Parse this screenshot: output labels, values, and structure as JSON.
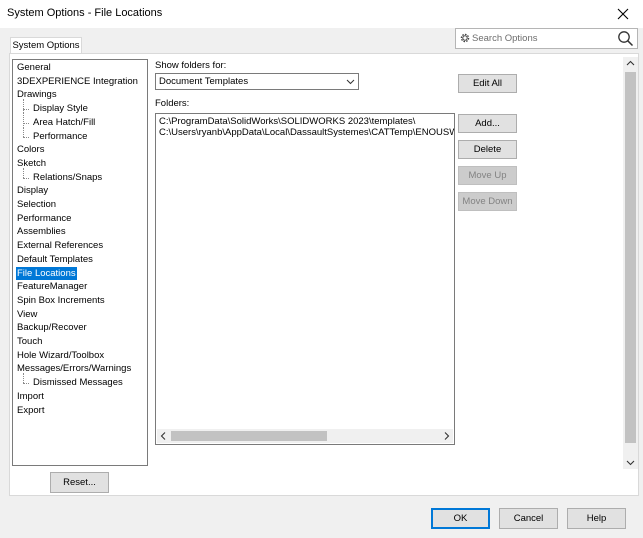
{
  "window": {
    "title": "System Options - File Locations"
  },
  "tabs": [
    {
      "label": "System Options"
    }
  ],
  "search": {
    "placeholder": "Search Options"
  },
  "tree": {
    "items": [
      {
        "label": "General",
        "indent": 0
      },
      {
        "label": "3DEXPERIENCE Integration",
        "indent": 0
      },
      {
        "label": "Drawings",
        "indent": 0
      },
      {
        "label": "Display Style",
        "indent": 1
      },
      {
        "label": "Area Hatch/Fill",
        "indent": 1
      },
      {
        "label": "Performance",
        "indent": 1
      },
      {
        "label": "Colors",
        "indent": 0
      },
      {
        "label": "Sketch",
        "indent": 0
      },
      {
        "label": "Relations/Snaps",
        "indent": 1
      },
      {
        "label": "Display",
        "indent": 0
      },
      {
        "label": "Selection",
        "indent": 0
      },
      {
        "label": "Performance",
        "indent": 0
      },
      {
        "label": "Assemblies",
        "indent": 0
      },
      {
        "label": "External References",
        "indent": 0
      },
      {
        "label": "Default Templates",
        "indent": 0
      },
      {
        "label": "File Locations",
        "indent": 0,
        "selected": true
      },
      {
        "label": "FeatureManager",
        "indent": 0
      },
      {
        "label": "Spin Box Increments",
        "indent": 0
      },
      {
        "label": "View",
        "indent": 0
      },
      {
        "label": "Backup/Recover",
        "indent": 0
      },
      {
        "label": "Touch",
        "indent": 0
      },
      {
        "label": "Hole Wizard/Toolbox",
        "indent": 0
      },
      {
        "label": "Messages/Errors/Warnings",
        "indent": 0
      },
      {
        "label": "Dismissed Messages",
        "indent": 1
      },
      {
        "label": "Import",
        "indent": 0
      },
      {
        "label": "Export",
        "indent": 0
      }
    ]
  },
  "show_folders": {
    "label": "Show folders for:",
    "selected": "Document Templates"
  },
  "folders": {
    "label": "Folders:",
    "entries": [
      "C:\\ProgramData\\SolidWorks\\SOLIDWORKS 2023\\templates\\",
      "C:\\Users\\ryanb\\AppData\\Local\\DassaultSystemes\\CATTemp\\ENOUSWC\\Re"
    ]
  },
  "buttons": {
    "edit_all": "Edit All",
    "add": "Add...",
    "delete": "Delete",
    "move_up": "Move Up",
    "move_down": "Move Down",
    "reset": "Reset...",
    "ok": "OK",
    "cancel": "Cancel",
    "help": "Help"
  },
  "colors": {
    "selection": "#0078d7",
    "default_button_border": "#0078d7"
  }
}
